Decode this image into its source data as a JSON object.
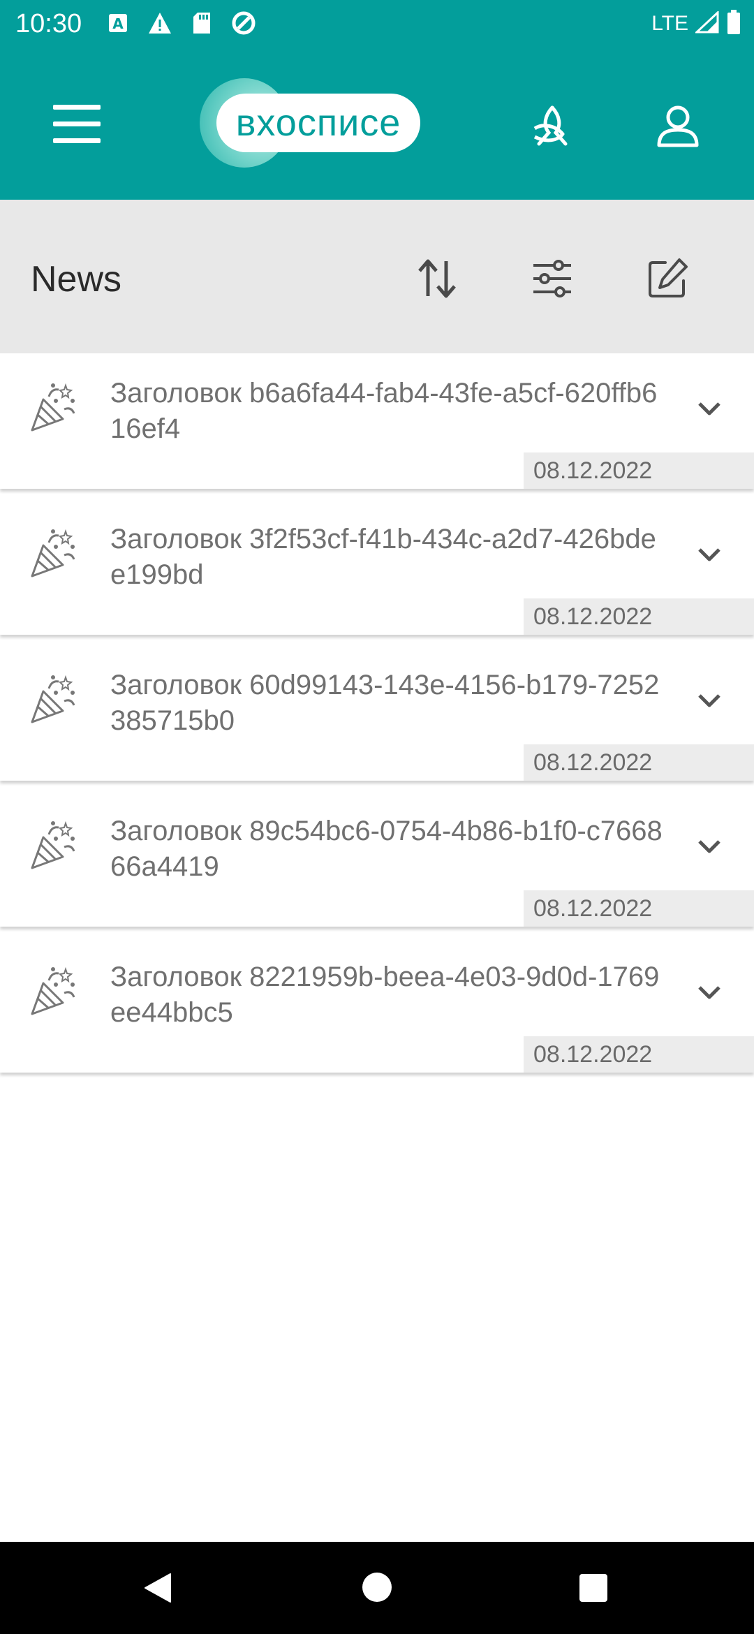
{
  "status_bar": {
    "time": "10:30",
    "network": "LTE",
    "icons": [
      "a-notification-icon",
      "warning-icon",
      "sd-card-icon",
      "data-saver-icon",
      "signal-icon",
      "battery-icon"
    ]
  },
  "header": {
    "logo_text": "вхосписе",
    "menu_icon": "hamburger-menu-icon",
    "ribbon_icon": "ribbon-icon",
    "profile_icon": "profile-icon",
    "accent_color": "#039e9b"
  },
  "toolbar": {
    "title": "News",
    "sort_icon": "sort-icon",
    "filter_icon": "filter-icon",
    "edit_icon": "edit-icon"
  },
  "news": [
    {
      "title": "Заголовок b6a6fa44-fab4-43fe-a5cf-620ffb616ef4",
      "date": "08.12.2022"
    },
    {
      "title": "Заголовок 3f2f53cf-f41b-434c-a2d7-426bdee199bd",
      "date": "08.12.2022"
    },
    {
      "title": "Заголовок 60d99143-143e-4156-b179-7252385715b0",
      "date": "08.12.2022"
    },
    {
      "title": "Заголовок 89c54bc6-0754-4b86-b1f0-c766866a4419",
      "date": "08.12.2022"
    },
    {
      "title": "Заголовок 8221959b-beea-4e03-9d0d-1769ee44bbc5",
      "date": "08.12.2022"
    }
  ]
}
